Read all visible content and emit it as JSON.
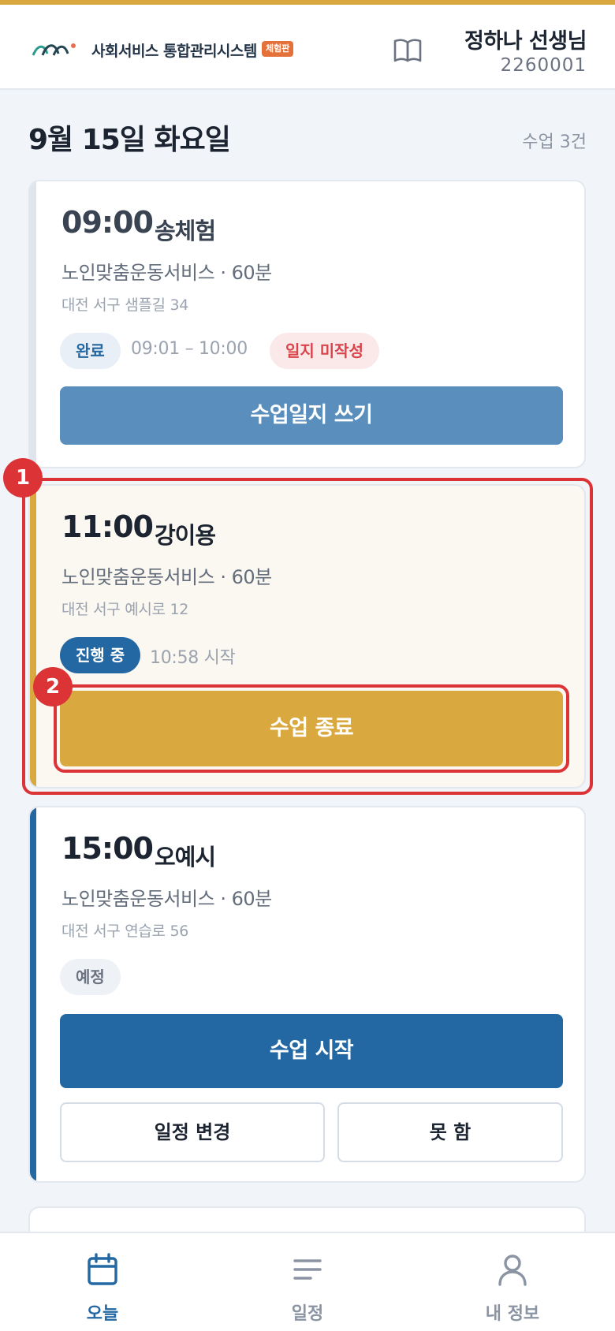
{
  "header": {
    "app_title": "사회서비스 통합관리시스템",
    "trial_badge": "체험판",
    "teacher_name": "정하나 선생님",
    "teacher_id": "2260001"
  },
  "day": {
    "date_title": "9월 15일 화요일",
    "class_count": "수업 3건"
  },
  "cards": [
    {
      "time": "09:00",
      "student": "송체험",
      "service": "노인맞춤운동서비스 · 60분",
      "address": "대전 서구 샘플길 34",
      "status": "완료",
      "status_time": "09:01 – 10:00",
      "journal_badge": "일지 미작성",
      "primary_button": "수업일지 쓰기"
    },
    {
      "time": "11:00",
      "student": "강이용",
      "service": "노인맞춤운동서비스 · 60분",
      "address": "대전 서구 예시로 12",
      "status": "진행 중",
      "status_time": "10:58 시작",
      "primary_button": "수업 종료"
    },
    {
      "time": "15:00",
      "student": "오예시",
      "service": "노인맞춤운동서비스 · 60분",
      "address": "대전 서구 연습로 56",
      "status": "예정",
      "primary_button": "수업 시작",
      "secondary_buttons": [
        "일정 변경",
        "못 함"
      ]
    }
  ],
  "markers": [
    "1",
    "2"
  ],
  "bottom_nav": [
    {
      "label": "오늘",
      "icon": "calendar-icon",
      "active": true
    },
    {
      "label": "일정",
      "icon": "list-icon",
      "active": false
    },
    {
      "label": "내 정보",
      "icon": "user-icon",
      "active": false
    }
  ],
  "colors": {
    "accent_gold": "#d9a93f",
    "primary_blue": "#2468a3",
    "muted_blue": "#5a8fbd",
    "alert_red": "#dc3337"
  }
}
